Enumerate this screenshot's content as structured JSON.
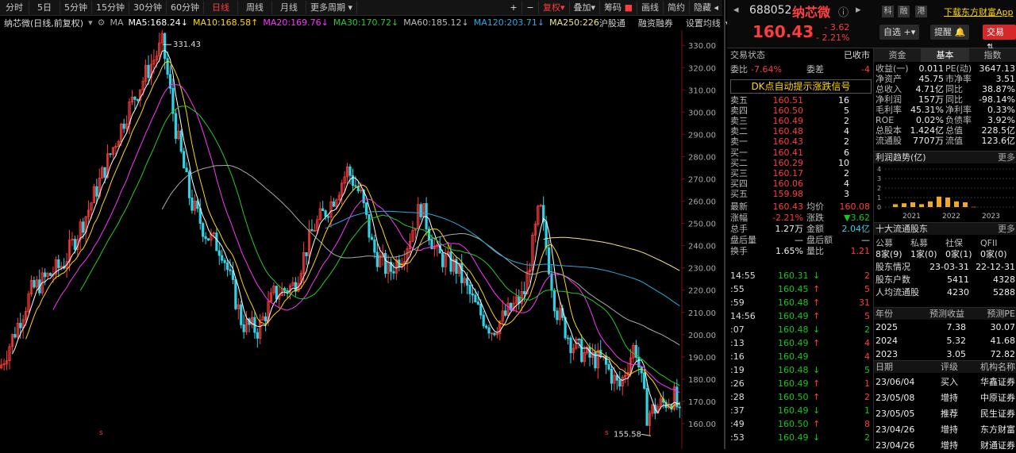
{
  "toolbar": {
    "periods": [
      "分时",
      "5日",
      "5分钟",
      "15分钟",
      "30分钟",
      "60分钟",
      "日线",
      "周线",
      "月线",
      "更多周期"
    ],
    "active_period": "日线",
    "plus": "+",
    "minus": "−",
    "fuquan": "复权",
    "overlay": "叠加",
    "chouma": "筹码",
    "huaxian": "画线",
    "jianyue": "简约",
    "hide": "隐藏"
  },
  "ma_bar": {
    "stock": "纳芯微",
    "mode": "(日线,前复权)",
    "ma_label": "MA",
    "ma5": "MA5:168.24↓",
    "ma10": "MA10:168.58↑",
    "ma20": "MA20:169.76↓",
    "ma30": "MA30:170.72↓",
    "ma60": "MA60:185.12↓",
    "ma120": "MA120:203.71↓",
    "ma250": "MA250:226",
    "hugu": "沪股通",
    "rongzi": "融资融券",
    "setting": "设置均线"
  },
  "chart_data": {
    "type": "candlestick",
    "y_ticks": [
      330.0,
      320.0,
      310.0,
      300.0,
      290.0,
      280.0,
      270.0,
      260.0,
      250.0,
      240.0,
      230.0,
      220.0,
      210.0,
      200.0,
      190.0,
      180.0,
      170.0,
      160.0
    ],
    "ylim": [
      155,
      334
    ],
    "high_label": "331.43",
    "low_label": "155.58",
    "colors": {
      "up": "#ff3c3c",
      "down": "#2fd3e6",
      "ma5": "#ffffff",
      "ma10": "#ffd700",
      "ma20": "#ff33ff",
      "ma30": "#22cc22",
      "ma60": "#aaaaaa",
      "ma120": "#2aa9e0",
      "ma250": "#f0e68c"
    }
  },
  "header": {
    "code": "688052",
    "name": "纳芯微",
    "price": "160.43",
    "change": "- 3.62",
    "pct": "- 2.21%",
    "tags": [
      "科",
      "融",
      "港"
    ],
    "download": "下载东方财富App",
    "zixuan": "自选",
    "tixing": "提醒",
    "jiaoyi": "交易"
  },
  "orderbook": {
    "status_label": "交易状态",
    "status": "已收市",
    "weibi_label": "委比",
    "weibi": "-7.64%",
    "weicha_label": "委差",
    "weicha": "-4",
    "dk": "DK点自动提示涨跌信号",
    "asks": [
      {
        "label": "卖五",
        "price": "160.51",
        "vol": "16"
      },
      {
        "label": "卖四",
        "price": "160.50",
        "vol": "5"
      },
      {
        "label": "卖三",
        "price": "160.49",
        "vol": "2"
      },
      {
        "label": "卖二",
        "price": "160.48",
        "vol": "4"
      },
      {
        "label": "卖一",
        "price": "160.43",
        "vol": "2"
      }
    ],
    "bids": [
      {
        "label": "买一",
        "price": "160.41",
        "vol": "6"
      },
      {
        "label": "买二",
        "price": "160.29",
        "vol": "10"
      },
      {
        "label": "买三",
        "price": "160.17",
        "vol": "2"
      },
      {
        "label": "买四",
        "price": "160.06",
        "vol": "4"
      },
      {
        "label": "买五",
        "price": "159.98",
        "vol": "3"
      }
    ],
    "stats": [
      {
        "l1": "最新",
        "v1": "160.43",
        "c1": "red",
        "l2": "均价",
        "v2": "160.08",
        "c2": "red"
      },
      {
        "l1": "涨幅",
        "v1": "-2.21%",
        "c1": "red",
        "l2": "涨跌",
        "v2": "▼3.62",
        "c2": "green"
      },
      {
        "l1": "总手",
        "v1": "1.27万",
        "c1": "white",
        "l2": "金额",
        "v2": "2.04亿",
        "c2": "cyan"
      },
      {
        "l1": "盘后量",
        "v1": "—",
        "c1": "white",
        "l2": "盘后额",
        "v2": "—",
        "c2": "white"
      },
      {
        "l1": "换手",
        "v1": "1.65%",
        "c1": "white",
        "l2": "量比",
        "v2": "1.21",
        "c2": "red"
      }
    ],
    "ticks": [
      {
        "t": "14:55",
        "p": "160.31",
        "a": "↓",
        "v": "2",
        "vc": "red"
      },
      {
        "t": ":55",
        "p": "160.45",
        "a": "↑",
        "v": "5",
        "vc": "red"
      },
      {
        "t": ":59",
        "p": "160.48",
        "a": "↑",
        "v": "31",
        "vc": "red"
      },
      {
        "t": "14:56",
        "p": "160.49",
        "a": "↑",
        "v": "5",
        "vc": "red"
      },
      {
        "t": ":07",
        "p": "160.48",
        "a": "↓",
        "v": "2",
        "vc": "green"
      },
      {
        "t": ":13",
        "p": "160.49",
        "a": "↑",
        "v": "4",
        "vc": "red"
      },
      {
        "t": ":16",
        "p": "160.49",
        "a": "",
        "v": "4",
        "vc": "red"
      },
      {
        "t": ":19",
        "p": "160.48",
        "a": "↓",
        "v": "5",
        "vc": "green"
      },
      {
        "t": ":26",
        "p": "160.49",
        "a": "↑",
        "v": "1",
        "vc": "red"
      },
      {
        "t": ":28",
        "p": "160.50",
        "a": "↑",
        "v": "2",
        "vc": "red"
      },
      {
        "t": ":37",
        "p": "160.49",
        "a": "↓",
        "v": "1",
        "vc": "green"
      },
      {
        "t": ":49",
        "p": "160.50",
        "a": "↑",
        "v": "8",
        "vc": "red"
      },
      {
        "t": ":53",
        "p": "160.49",
        "a": "↓",
        "v": "2",
        "vc": "green"
      }
    ]
  },
  "fund": {
    "tabs": [
      "资金",
      "基本",
      "指数"
    ],
    "rows": [
      {
        "l1": "收益(一)",
        "v1": "0.011",
        "l2": "PE(动)",
        "v2": "3647.13"
      },
      {
        "l1": "净资产",
        "v1": "45.75",
        "l2": "市净率",
        "v2": "3.51"
      },
      {
        "l1": "总收入",
        "v1": "4.71亿",
        "l2": "同比",
        "v2": "38.87%"
      },
      {
        "l1": "净利润",
        "v1": "157万",
        "l2": "同比",
        "v2": "-98.14%"
      },
      {
        "l1": "毛利率",
        "v1": "45.31%",
        "l2": "净利率",
        "v2": "0.33%"
      },
      {
        "l1": "ROE",
        "v1": "0.02%",
        "l2": "负债率",
        "v2": "3.92%"
      },
      {
        "l1": "总股本",
        "v1": "1.424亿",
        "l2": "总值",
        "v2": "228.5亿"
      },
      {
        "l1": "流通股",
        "v1": "7707万",
        "l2": "流值",
        "v2": "123.6亿"
      }
    ],
    "profit_title": "利润趋势(亿)",
    "more": "更多",
    "profit_y": [
      "4",
      "3",
      "2",
      "1",
      "0"
    ],
    "profit_years": [
      "2021",
      "2022",
      "2023"
    ],
    "profit_bars": [
      0.3,
      0.4,
      0.5,
      0.3,
      0.6,
      1.1,
      1.0,
      0.6,
      0.5,
      0.02
    ],
    "holders_title": "十大流通股东",
    "holder_tabs": [
      "公募",
      "私募",
      "社保",
      "QFII"
    ],
    "holder_vals": [
      "8家(9)",
      "1家(0)",
      "0家(1)",
      "0家(0)"
    ],
    "holder_rows": [
      {
        "l": "股东情况",
        "a": "23-03-31",
        "b": "22-12-31"
      },
      {
        "l": "股东户数",
        "a": "5411",
        "b": "4328"
      },
      {
        "l": "人均流通股",
        "a": "4230",
        "b": "5288"
      }
    ],
    "forecast_head": [
      "年份",
      "预测收益",
      "预测PE"
    ],
    "forecast": [
      {
        "y": "2025",
        "e": "7.38",
        "pe": "30.07"
      },
      {
        "y": "2024",
        "e": "5.32",
        "pe": "41.68"
      },
      {
        "y": "2023",
        "e": "3.05",
        "pe": "72.82"
      }
    ],
    "rating_head": [
      "日期",
      "评级",
      "机构名称"
    ],
    "ratings": [
      {
        "d": "23/06/04",
        "r": "买入",
        "o": "华鑫证券"
      },
      {
        "d": "23/05/08",
        "r": "增持",
        "o": "中原证券"
      },
      {
        "d": "23/05/05",
        "r": "推荐",
        "o": "民生证券"
      },
      {
        "d": "23/04/26",
        "r": "增持",
        "o": "东方财富"
      },
      {
        "d": "23/04/26",
        "r": "增持",
        "o": "财通证券"
      }
    ]
  }
}
